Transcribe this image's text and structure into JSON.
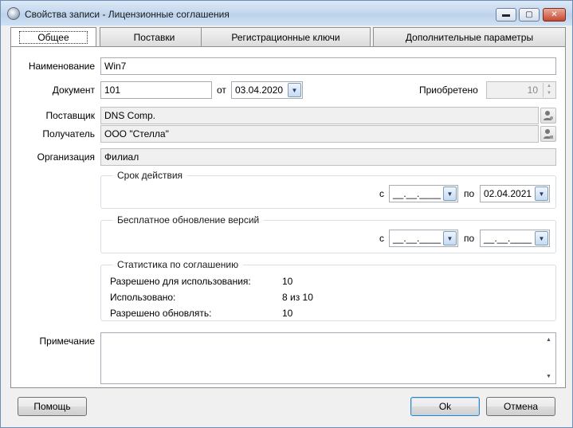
{
  "window": {
    "title": "Свойства записи - Лицензионные соглашения",
    "minimize_glyph": "▬",
    "maximize_glyph": "▢",
    "close_glyph": "✕"
  },
  "tabs": [
    {
      "label": "Общее",
      "active": true
    },
    {
      "label": "Поставки"
    },
    {
      "label": "Регистрационные ключи"
    },
    {
      "label": "Дополнительные параметры"
    }
  ],
  "form": {
    "name": {
      "label": "Наименование",
      "value": "Win7"
    },
    "document": {
      "label": "Документ",
      "value": "101"
    },
    "doc_date": {
      "label": "от",
      "value": "03.04.2020"
    },
    "acquired": {
      "label": "Приобретено",
      "value": "10"
    },
    "supplier": {
      "label": "Поставщик",
      "value": "DNS Comp."
    },
    "recipient": {
      "label": "Получатель",
      "value": "ООО \"Стелла\""
    },
    "organization": {
      "label": "Организация",
      "value": "Филиал"
    },
    "validity": {
      "title": "Срок действия",
      "from_label": "с",
      "from_value": "__.__.____",
      "to_label": "по",
      "to_value": "02.04.2021"
    },
    "free_update": {
      "title": "Бесплатное обновление версий",
      "from_label": "с",
      "from_value": "__.__.____",
      "to_label": "по",
      "to_value": "__.__.____"
    },
    "stats": {
      "title": "Статистика по соглашению",
      "rows": [
        {
          "label": "Разрешено для использования:",
          "value": "10"
        },
        {
          "label": "Использовано:",
          "value": "8 из 10"
        },
        {
          "label": "Разрешено обновлять:",
          "value": "10"
        }
      ]
    },
    "note": {
      "label": "Примечание",
      "value": ""
    }
  },
  "buttons": {
    "help": "Помощь",
    "ok": "Ok",
    "cancel": "Отмена"
  },
  "icons": {
    "combo": "▼",
    "spin_up": "▲",
    "spin_down": "▼"
  }
}
